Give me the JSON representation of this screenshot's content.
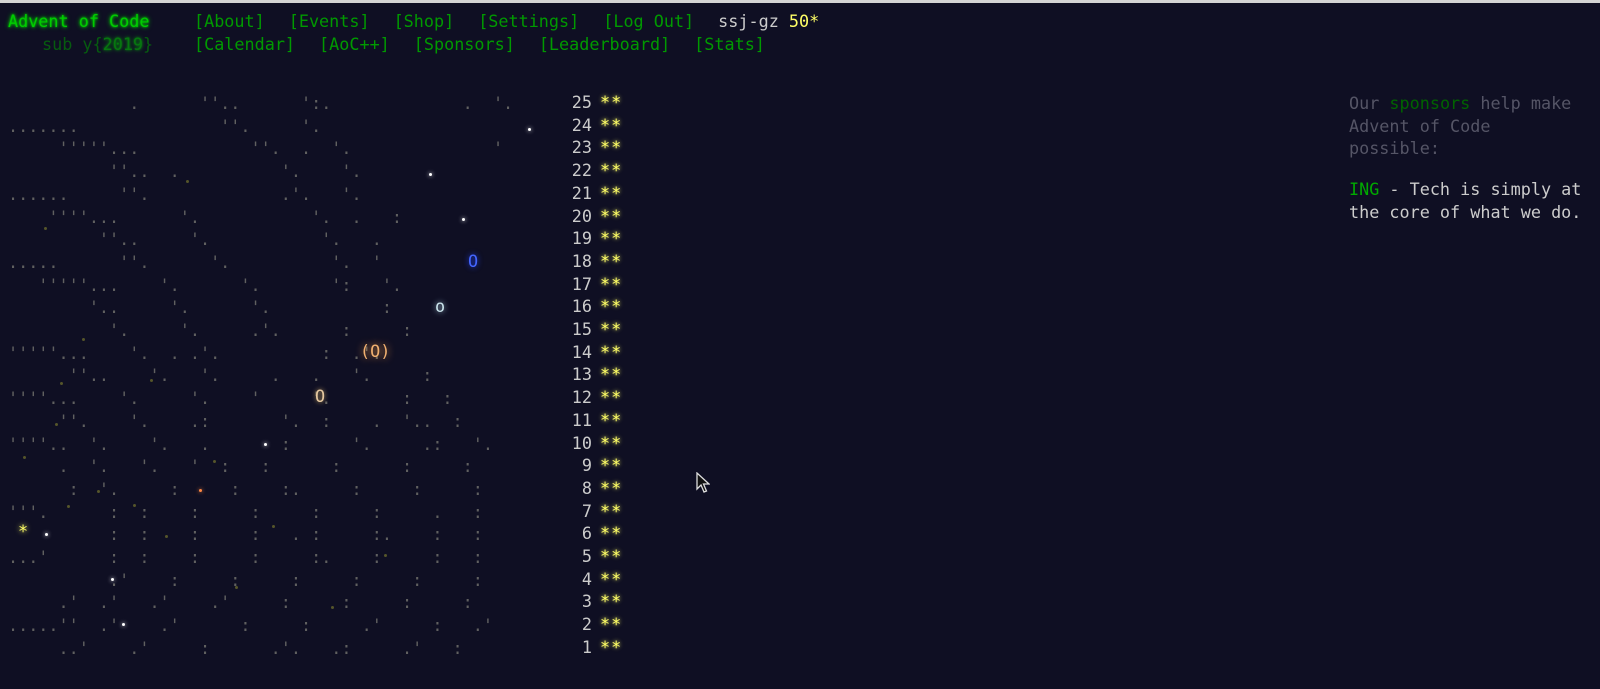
{
  "header": {
    "title": "Advent of Code",
    "subtitle_prefix": "sub y{",
    "year": "2019",
    "subtitle_suffix": "}",
    "nav_row1": [
      "[About]",
      "[Events]",
      "[Shop]",
      "[Settings]",
      "[Log Out]"
    ],
    "user": "ssj-gz",
    "star_count": "50*",
    "nav_row2": [
      "[Calendar]",
      "[AoC++]",
      "[Sponsors]",
      "[Leaderboard]",
      "[Stats]"
    ]
  },
  "calendar": {
    "days": [
      {
        "day": "25",
        "stars": "**"
      },
      {
        "day": "24",
        "stars": "**"
      },
      {
        "day": "23",
        "stars": "**"
      },
      {
        "day": "22",
        "stars": "**"
      },
      {
        "day": "21",
        "stars": "**"
      },
      {
        "day": "20",
        "stars": "**"
      },
      {
        "day": "19",
        "stars": "**"
      },
      {
        "day": "18",
        "stars": "**"
      },
      {
        "day": "17",
        "stars": "**"
      },
      {
        "day": "16",
        "stars": "**"
      },
      {
        "day": "15",
        "stars": "**"
      },
      {
        "day": "14",
        "stars": "**"
      },
      {
        "day": "13",
        "stars": "**"
      },
      {
        "day": "12",
        "stars": "**"
      },
      {
        "day": "11",
        "stars": "**"
      },
      {
        "day": "10",
        "stars": "**"
      },
      {
        "day": "9",
        "stars": "**"
      },
      {
        "day": "8",
        "stars": "**"
      },
      {
        "day": "7",
        "stars": "**"
      },
      {
        "day": "6",
        "stars": "**"
      },
      {
        "day": "5",
        "stars": "**"
      },
      {
        "day": "4",
        "stars": "**"
      },
      {
        "day": "3",
        "stars": "**"
      },
      {
        "day": "2",
        "stars": "**"
      },
      {
        "day": "1",
        "stars": "**"
      }
    ],
    "art": [
      "            .      ''..      ':.             .  '.",
      ".......              ''.     '.",
      "     '''''...           ''.  .  '.              '",
      "          ''..  .          '.    '.",
      "......     ''.             .'.   '.",
      "    ''''...      '.           '.  .   :",
      "         ''..     '.           '.   .",
      ".....      ''.      '.          '.  '",
      "   '''''...    '.      '.       ':   '.",
      "        '..     '.      '.           :",
      "          '.     '.     .'.      :     :",
      "'''''...    '.  . .'.          :  .'.",
      "      ''..    '.   '.     .   .   '.     :",
      "''''...    '.     '.    '     '.       :   :",
      "     ''.    '.    .:       '.  :    .  '..  :",
      "''''..  '.    '.   .       :      '.     .:   '.",
      "     .  '.   '.   '  :   :      :      :     :",
      "      :  '.     :     :    :.     :     :     :",
      "'''.      :  :    :     :     :     :     .   :",
      "          :  :    :     :   . :     :.    :   :",
      "...'      :  :    :     :     :.    :     :   :",
      "          .'    :     :     :     :     :     :",
      "     .'  .'   .'    .'     :     :     :     :",
      ".....''  .'    .'      :     :     .'     :   .'",
      "     ..'    .'     :      .'.   .:     .'   :"
    ]
  },
  "sidebar": {
    "intro_before": "Our ",
    "intro_link": "sponsors",
    "intro_after": " help make Advent of Code possible:",
    "sponsor_name": "ING",
    "sponsor_text": " - Tech is simply at the core of what we do."
  }
}
